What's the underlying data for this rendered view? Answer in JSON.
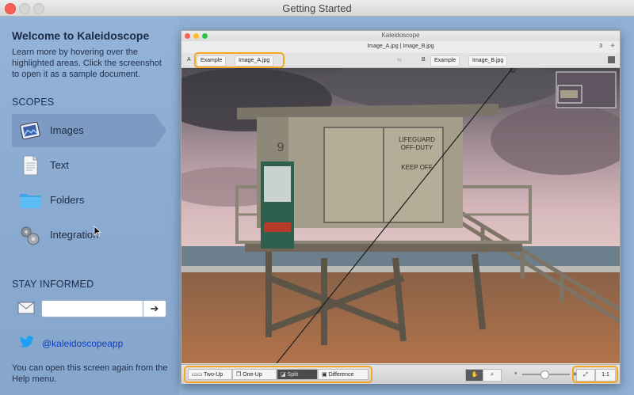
{
  "window": {
    "title": "Getting Started"
  },
  "sidebar": {
    "welcome_title": "Welcome to Kaleidoscope",
    "welcome_text": "Learn more by hovering over the highlighted areas. Click the screenshot to open it as a sample document.",
    "scopes_heading": "SCOPES",
    "scopes": [
      {
        "label": "Images",
        "icon": "images-icon"
      },
      {
        "label": "Text",
        "icon": "text-document-icon"
      },
      {
        "label": "Folders",
        "icon": "folder-icon"
      },
      {
        "label": "Integration",
        "icon": "gears-icon"
      }
    ],
    "stay_heading": "STAY INFORMED",
    "email_value": "",
    "email_submit": "➔",
    "twitter_handle": "@kaleidoscopeapp",
    "bottom_note": "You can open this screen again from the Help menu."
  },
  "preview": {
    "window_title": "Kaleidoscope",
    "files": "Image_A.jpg | Image_B.jpg",
    "count": "3",
    "plus": "+",
    "side_a": {
      "label": "A",
      "crumb1": "Example",
      "crumb2": "Image_A.jpg"
    },
    "side_b": {
      "label": "B",
      "crumb1": "Example",
      "crumb2": "Image_B.jpg"
    },
    "lifeguard_sign": [
      "LIFEGUARD",
      "OFF-DUTY",
      "KEEP OFF"
    ],
    "tower_number": "9",
    "modes": [
      "Two-Up",
      "One-Up",
      "Split",
      "Difference"
    ],
    "active_mode": "Split",
    "zoom_level": 0.45,
    "actual_size_label": "1:1"
  },
  "colors": {
    "highlight": "#f5a623",
    "link": "#0f3ec0",
    "close": "#fc5f57"
  }
}
